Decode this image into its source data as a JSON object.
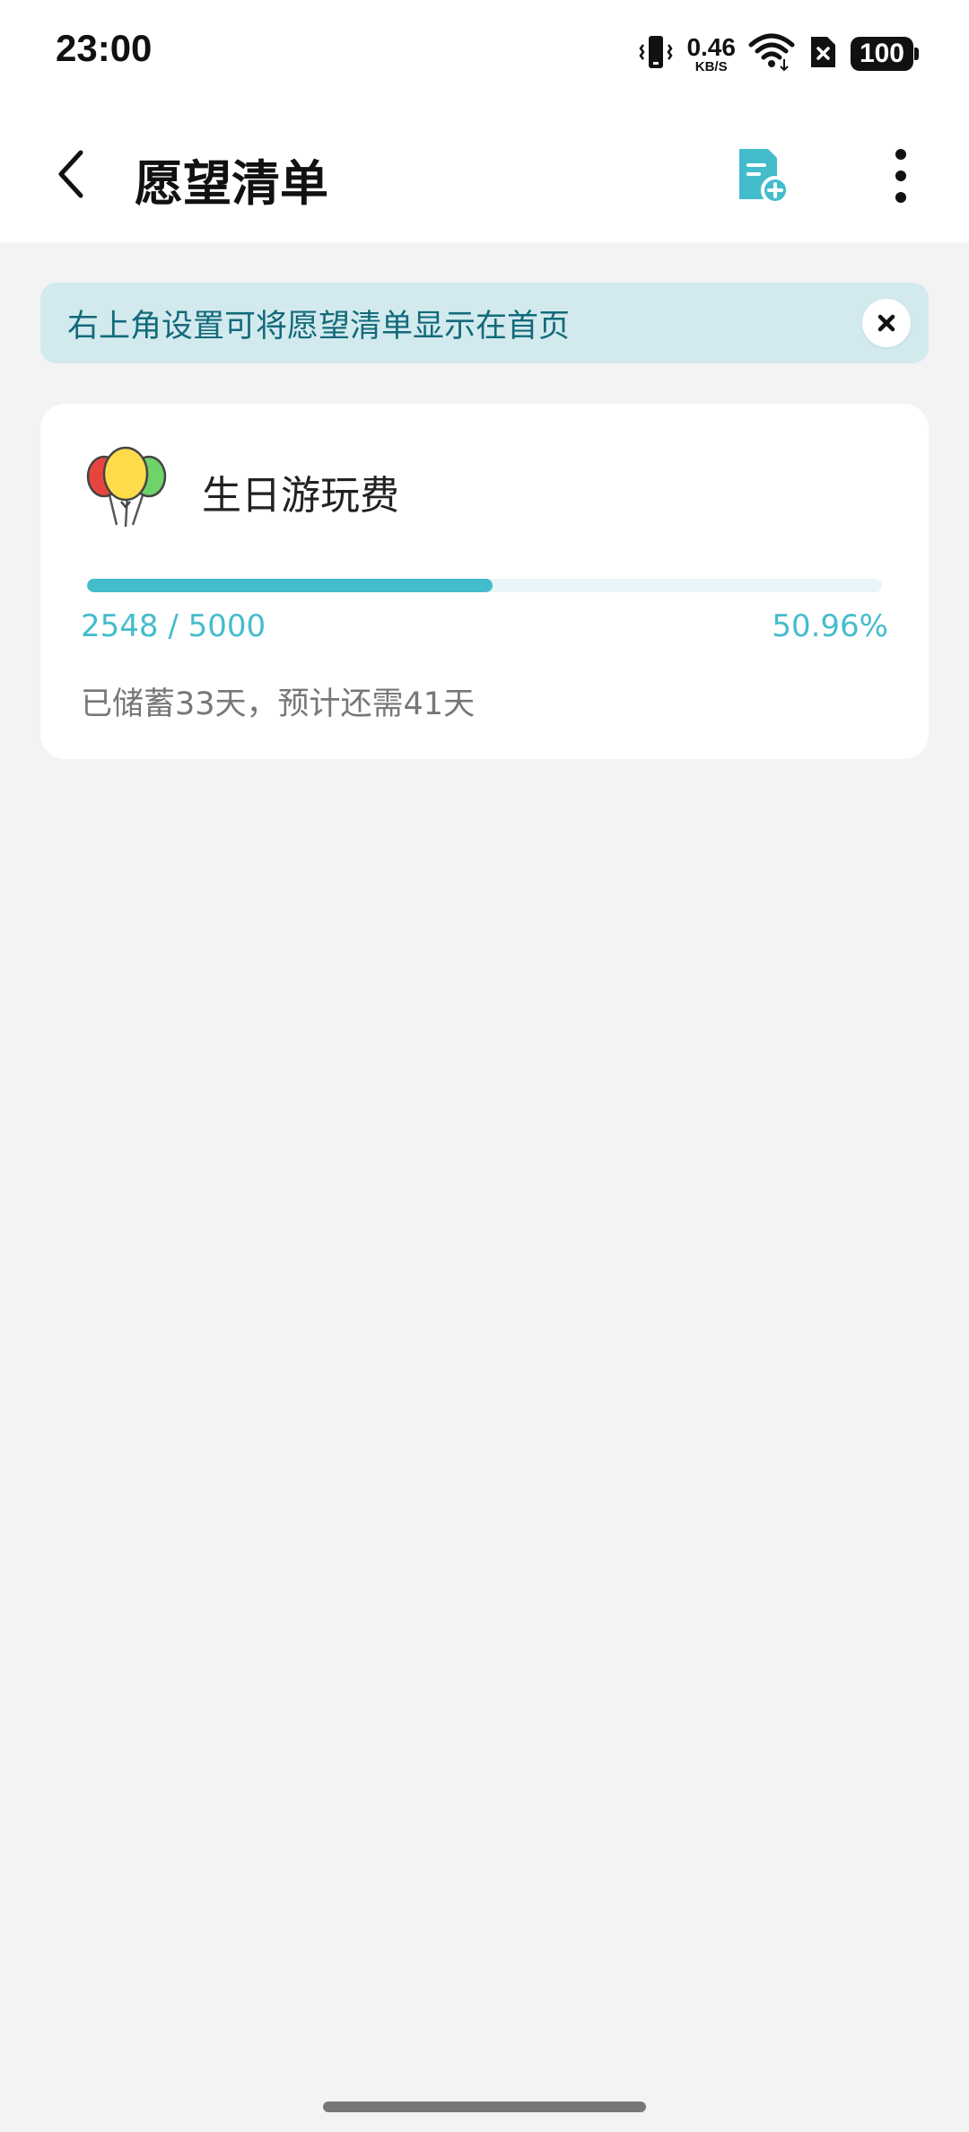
{
  "status_bar": {
    "time": "23:00",
    "net_speed_value": "0.46",
    "net_speed_unit": "KB/S",
    "battery": "100",
    "icons": [
      "vibrate-icon",
      "wifi-icon",
      "no-sim-icon",
      "battery-icon"
    ]
  },
  "app_bar": {
    "title": "愿望清单",
    "icons": [
      "back-arrow-icon",
      "add-list-icon",
      "more-vert-icon"
    ]
  },
  "tip": {
    "text": "右上角设置可将愿望清单显示在首页",
    "close_icon": "close-icon"
  },
  "wishes": [
    {
      "icon": "balloons-icon",
      "name": "生日游玩费",
      "amount_text": "2548 / 5000",
      "saved": 2548,
      "target": 5000,
      "progress": 0.5096,
      "percent_text": "50.96%",
      "info": "已储蓄33天，预计还需41天"
    }
  ],
  "colors": {
    "accent": "#43bccc",
    "banner_bg": "#d2eaee",
    "banner_text": "#136a7a",
    "page_bg": "#f3f3f3"
  }
}
